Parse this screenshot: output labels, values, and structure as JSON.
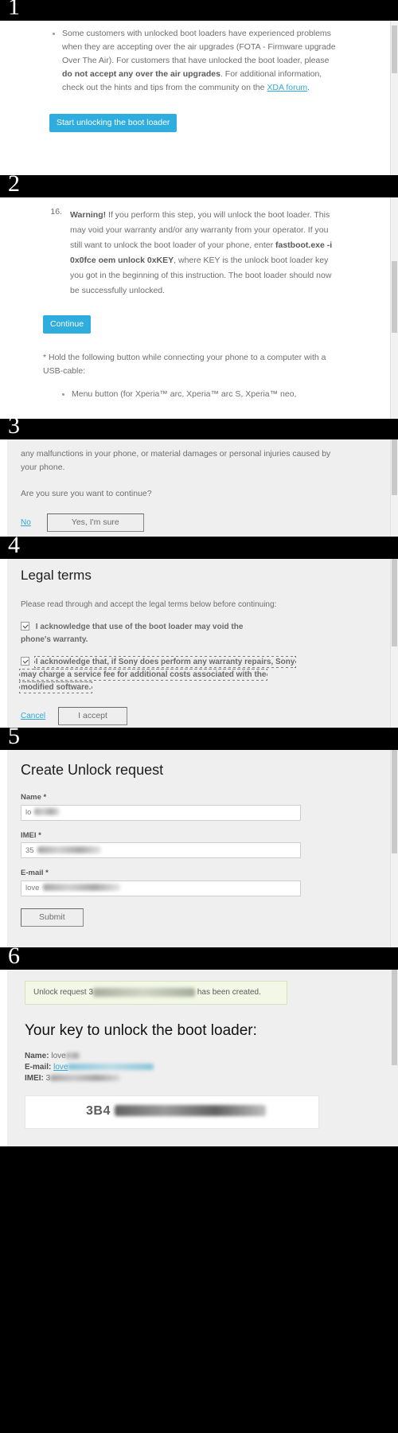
{
  "meta": {
    "steps": [
      "1",
      "2",
      "3",
      "4",
      "5",
      "6"
    ]
  },
  "panel1": {
    "bullet": {
      "part1": "Some customers with unlocked boot loaders have experienced problems when they are accepting over the air upgrades (FOTA - Firmware upgrade Over The Air). For customers that have unlocked the boot loader, please ",
      "bold1": "do not accept any over the air upgrades",
      "part2": ". For additional information, check out the hints and tips from the community on the ",
      "link": "XDA forum",
      "part3": "."
    },
    "start_button": "Start unlocking the boot loader"
  },
  "panel2": {
    "step_number": "16.",
    "warning_label": "Warning!",
    "warn_part1": " If you perform this step, you will unlock the boot loader. This may void your warranty and/or any warranty from your operator. If you still want to unlock the boot loader of your phone, enter ",
    "command": "fastboot.exe -i 0x0fce oem unlock 0xKEY",
    "warn_part2": ", where KEY is the unlock boot loader key you got in the beginning of this instruction. The boot loader should now be successfully unlocked.",
    "continue_button": "Continue",
    "footnote": "* Hold the following button while connecting your phone to a computer with a USB-cable:",
    "footnote_bullet": "Menu button (for Xperia™ arc, Xperia™ arc S, Xperia™ neo,"
  },
  "panel3": {
    "para1": "any malfunctions in your phone, or material damages or personal injuries caused by your phone.",
    "para2": "Are you sure you want to continue?",
    "no_link": "No",
    "yes_button": "Yes, I'm sure"
  },
  "panel4": {
    "title": "Legal terms",
    "intro": "Please read through and accept the legal terms below before continuing:",
    "term1": "I acknowledge that use of the boot loader may void the phone's warranty.",
    "term2": "I acknowledge that, if Sony does perform any warranty repairs, Sony may charge a service fee for additional costs associated with the modified software.",
    "cancel_link": "Cancel",
    "accept_button": "I accept"
  },
  "panel5": {
    "title": "Create Unlock request",
    "fields": [
      {
        "label": "Name *",
        "value": "lo"
      },
      {
        "label": "IMEI *",
        "value": "35"
      },
      {
        "label": "E-mail *",
        "value": "love"
      }
    ],
    "submit_button": "Submit"
  },
  "panel6": {
    "notice_prefix": "Unlock request 3",
    "notice_suffix": " has been created.",
    "title": "Your key to unlock the boot loader:",
    "rows": [
      {
        "label": "Name:",
        "value": "love"
      },
      {
        "label": "E-mail:",
        "value": "love"
      },
      {
        "label": "IMEI:",
        "value": "3"
      }
    ],
    "key_prefix": "3B4"
  }
}
